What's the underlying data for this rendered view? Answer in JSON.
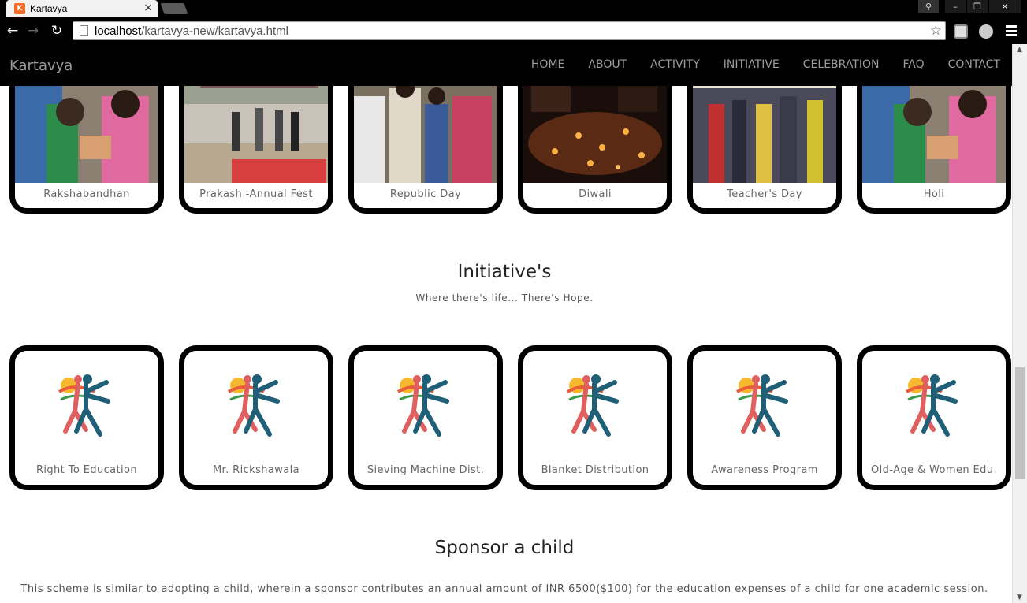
{
  "browser": {
    "tab_title": "Kartavya",
    "tab_favicon_text": "K",
    "url_host": "localhost",
    "url_path": "/kartavya-new/kartavya.html"
  },
  "site": {
    "brand": "Kartavya",
    "nav": [
      "HOME",
      "ABOUT",
      "ACTIVITY",
      "INITIATIVE",
      "CELEBRATION",
      "FAQ",
      "CONTACT"
    ]
  },
  "celebrations": [
    {
      "label": "Rakshabandhan",
      "photo": "children-tying-rakhi-photo"
    },
    {
      "label": "Prakash -Annual Fest",
      "photo": "prakash-banner-event-photo"
    },
    {
      "label": "Republic Day",
      "photo": "students-saluting-crowd-photo"
    },
    {
      "label": "Diwali",
      "photo": "diya-lamps-night-photo"
    },
    {
      "label": "Teacher's Day",
      "photo": "hall-gathering-photo"
    },
    {
      "label": "Holi",
      "photo": "children-tying-rakhi-photo"
    }
  ],
  "initiatives": {
    "title": "Initiative's",
    "subtitle": "Where there's life... There's Hope.",
    "items": [
      {
        "label": "Right To Education",
        "icon": "dancer-logo-icon"
      },
      {
        "label": "Mr. Rickshawala",
        "icon": "dancer-logo-icon"
      },
      {
        "label": "Sieving Machine Dist.",
        "icon": "dancer-logo-icon"
      },
      {
        "label": "Blanket Distribution",
        "icon": "dancer-logo-icon"
      },
      {
        "label": "Awareness Program",
        "icon": "dancer-logo-icon"
      },
      {
        "label": "Old-Age & Women Edu.",
        "icon": "dancer-logo-icon"
      }
    ]
  },
  "sponsor": {
    "title": "Sponsor a child",
    "text": "This scheme is similar to adopting a child, wherein a sponsor contributes an annual amount of INR 6500($100) for the education expenses of a child for one academic session."
  },
  "colors": {
    "nav_bg": "#000000",
    "nav_text": "#9d9d9d",
    "card_border": "#000000"
  }
}
